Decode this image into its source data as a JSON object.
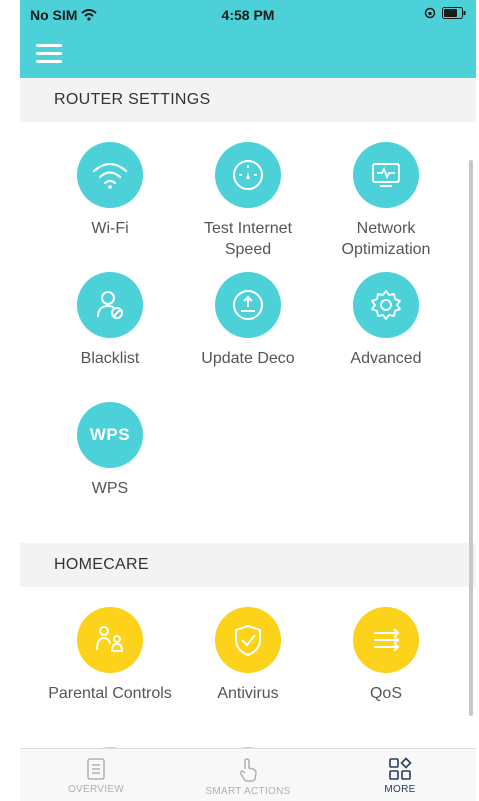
{
  "status": {
    "carrier": "No SIM",
    "time": "4:58 PM"
  },
  "sections": {
    "router": {
      "title": "ROUTER SETTINGS",
      "items": [
        {
          "label": "Wi-Fi",
          "icon": "wifi-icon"
        },
        {
          "label": "Test Internet Speed",
          "icon": "speedometer-icon"
        },
        {
          "label": "Network Optimization",
          "icon": "monitor-pulse-icon"
        },
        {
          "label": "Blacklist",
          "icon": "user-blocked-icon"
        },
        {
          "label": "Update Deco",
          "icon": "upload-icon"
        },
        {
          "label": "Advanced",
          "icon": "gear-icon"
        },
        {
          "label": "WPS",
          "icon_text": "WPS"
        }
      ]
    },
    "homecare": {
      "title": "HOMECARE",
      "items": [
        {
          "label": "Parental Controls",
          "icon": "parental-icon"
        },
        {
          "label": "Antivirus",
          "icon": "shield-icon"
        },
        {
          "label": "QoS",
          "icon": "qos-arrows-icon"
        }
      ]
    }
  },
  "tabs": [
    {
      "label": "OVERVIEW",
      "icon": "document-icon",
      "active": false
    },
    {
      "label": "SMART ACTIONS",
      "icon": "tap-hand-icon",
      "active": false
    },
    {
      "label": "MORE",
      "icon": "grid-icon",
      "active": true
    }
  ],
  "colors": {
    "accent": "#4dd1d8",
    "homecare": "#fcd21b",
    "active_tab": "#2a3c5a"
  }
}
